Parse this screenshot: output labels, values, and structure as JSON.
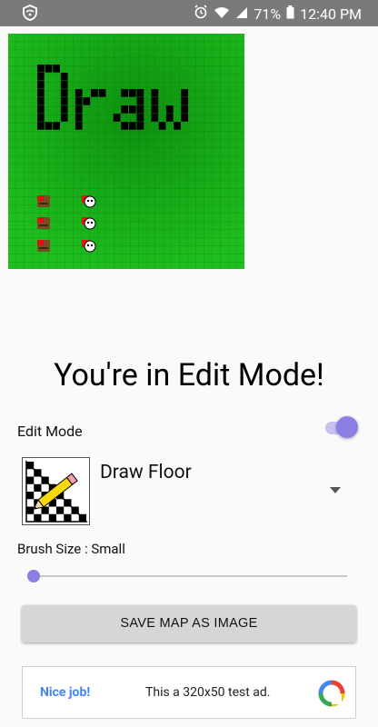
{
  "status_bar": {
    "battery": "71%",
    "time": "12:40 PM"
  },
  "map": {
    "text": "Draw"
  },
  "title": "You're in Edit Mode!",
  "edit_mode": {
    "label": "Edit Mode",
    "enabled": true
  },
  "tool": {
    "selected": "Draw Floor"
  },
  "brush": {
    "label": "Brush Size : Small",
    "value": 0
  },
  "save_button": "SAVE MAP AS IMAGE",
  "ad": {
    "headline": "Nice job!",
    "text": "This a 320x50 test ad."
  },
  "colors": {
    "accent": "#8b7ee4",
    "map_green": "#14a614"
  }
}
